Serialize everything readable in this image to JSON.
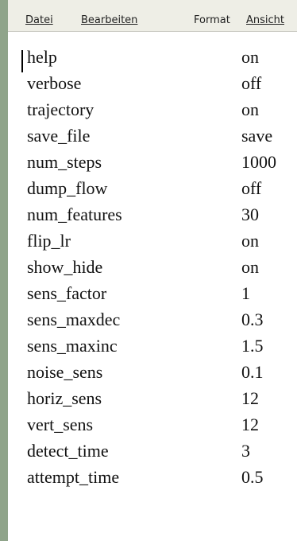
{
  "menubar": {
    "items": [
      {
        "label": "Datei"
      },
      {
        "label": "Bearbeiten"
      },
      {
        "label": "Format"
      },
      {
        "label": "Ansicht"
      }
    ]
  },
  "settings": [
    {
      "key": "help",
      "value": "on"
    },
    {
      "key": "verbose",
      "value": "off"
    },
    {
      "key": "trajectory",
      "value": "on"
    },
    {
      "key": "save_file",
      "value": "save"
    },
    {
      "key": "num_steps",
      "value": "1000"
    },
    {
      "key": "dump_flow",
      "value": "off"
    },
    {
      "key": "num_features",
      "value": "30"
    },
    {
      "key": "flip_lr",
      "value": "on"
    },
    {
      "key": "show_hide",
      "value": "on"
    },
    {
      "key": "sens_factor",
      "value": "1"
    },
    {
      "key": "sens_maxdec",
      "value": "0.3"
    },
    {
      "key": "sens_maxinc",
      "value": "1.5"
    },
    {
      "key": "noise_sens",
      "value": "0.1"
    },
    {
      "key": "horiz_sens",
      "value": "12"
    },
    {
      "key": "vert_sens",
      "value": "12"
    },
    {
      "key": "detect_time",
      "value": "3"
    },
    {
      "key": "attempt_time",
      "value": "0.5"
    }
  ]
}
